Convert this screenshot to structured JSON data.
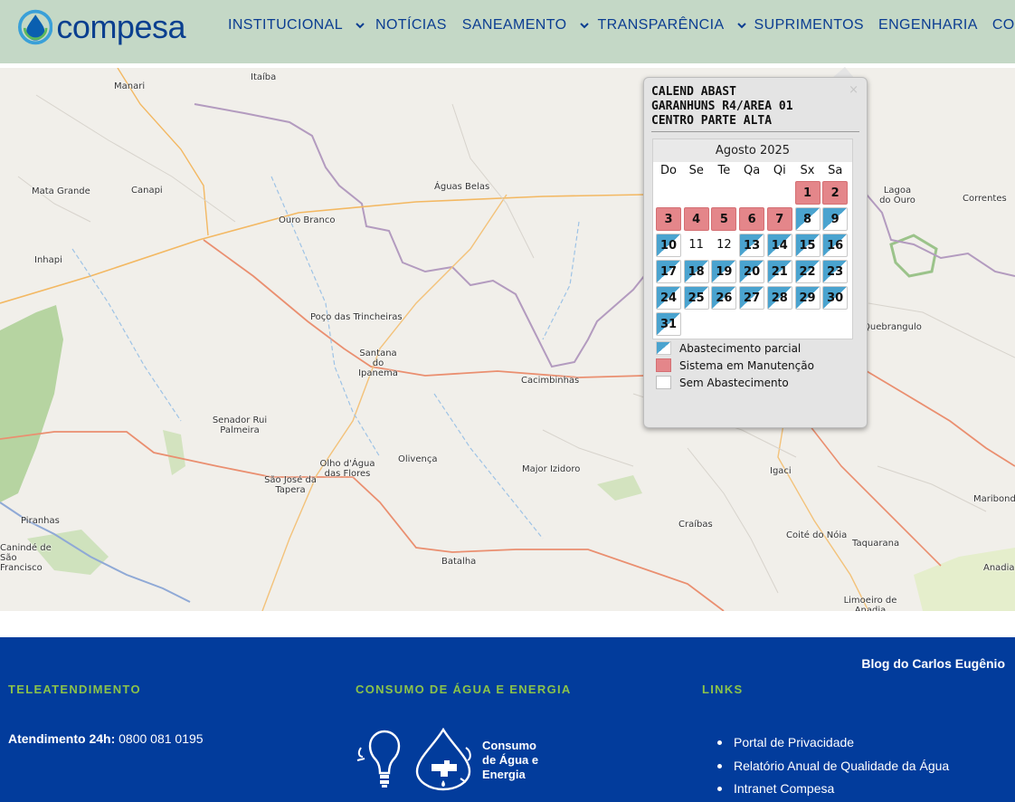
{
  "header": {
    "logo_text": "compesa",
    "nav": [
      {
        "label": "INSTITUCIONAL",
        "dropdown": true
      },
      {
        "label": "NOTÍCIAS",
        "dropdown": false
      },
      {
        "label": "SANEAMENTO",
        "dropdown": true
      },
      {
        "label": "TRANSPARÊNCIA",
        "dropdown": true
      },
      {
        "label": "SUPRIMENTOS",
        "dropdown": false
      },
      {
        "label": "ENGENHARIA",
        "dropdown": false
      },
      {
        "label": "CONTATO",
        "dropdown": false
      }
    ]
  },
  "map": {
    "places": [
      "Manari",
      "Itaíba",
      "Mata Grande",
      "Canapi",
      "Ouro Branco",
      "Águas Belas",
      "Lagoa do Ouro",
      "Correntes",
      "Inhapi",
      "Poço das Trincheiras",
      "Santana do Ipanema",
      "Cacimbinhas",
      "Quebrangulo",
      "Senador Rui Palmeira",
      "Olho d'Água das Flores",
      "Olivença",
      "Major Izidoro",
      "Igaci",
      "Maribondo",
      "São José da Tapera",
      "Piranhas",
      "Craíbas",
      "Coité do Nóia",
      "Taquarana",
      "Canindé de São Francisco",
      "Batalha",
      "Anadia",
      "Limoeiro de Anadia"
    ]
  },
  "popup": {
    "close": "×",
    "title_lines": [
      "CALEND ABAST",
      "GARANHUNS R4/AREA 01",
      "CENTRO PARTE ALTA"
    ],
    "calendar": {
      "month": "Agosto 2025",
      "weekdays": [
        "Do",
        "Se",
        "Te",
        "Qa",
        "Qi",
        "Sx",
        "Sa"
      ],
      "first_weekday": 5,
      "days_in_month": 31,
      "maintenance": [
        1,
        2,
        3,
        4,
        5,
        6,
        7
      ],
      "partial": [
        8,
        9,
        10,
        13,
        14,
        15,
        16,
        17,
        18,
        19,
        20,
        21,
        22,
        23,
        24,
        25,
        26,
        27,
        28,
        29,
        30,
        31
      ],
      "none": [
        11,
        12
      ]
    },
    "legend": [
      {
        "type": "partial",
        "label": "Abastecimento parcial"
      },
      {
        "type": "maint",
        "label": "Sistema em Manutenção"
      },
      {
        "type": "none",
        "label": "Sem Abastecimento"
      }
    ],
    "colors": {
      "partial": "#4aa3cf",
      "maintenance": "#e4868a",
      "none": "#ffffff"
    }
  },
  "footer": {
    "blog": "Blog do Carlos Eugênio",
    "col1_title": "TELEATENDIMENTO",
    "atend_label": "Atendimento 24h:",
    "atend_phone": "0800 081 0195",
    "col2_title": "CONSUMO DE ÁGUA E ENERGIA",
    "energy_lines": [
      "Consumo",
      "de Água e",
      "Energia"
    ],
    "col3_title": "LINKS",
    "links": [
      "Portal de Privacidade",
      "Relatório Anual de Qualidade da Água",
      "Intranet Compesa"
    ],
    "colors": {
      "background": "#023c9c",
      "accent": "#8bc34a"
    }
  }
}
